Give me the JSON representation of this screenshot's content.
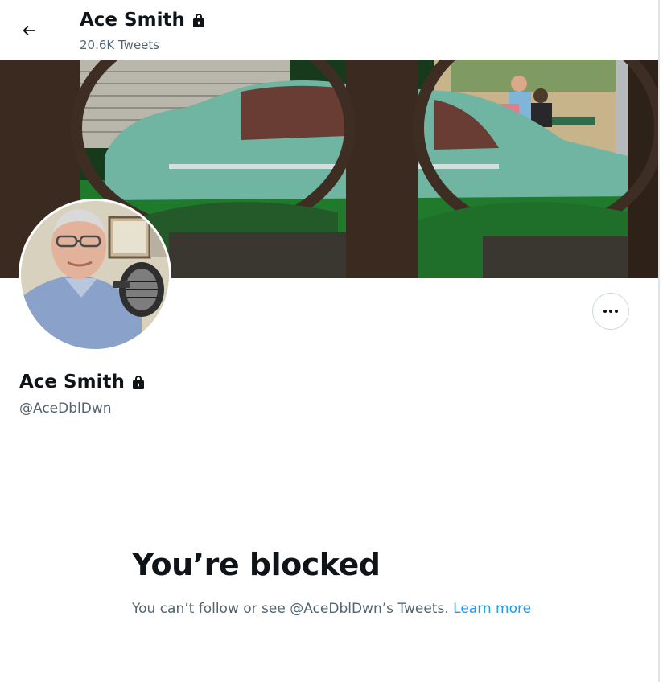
{
  "header": {
    "back_icon": "back-arrow-icon",
    "name": "Ace Smith",
    "lock_icon": "lock-icon",
    "tweet_count": "20.6K Tweets"
  },
  "banner": {
    "description_icon": "banner-image"
  },
  "profile": {
    "name": "Ace Smith",
    "lock_icon": "lock-icon",
    "handle": "@AceDblDwn",
    "more_icon": "more-options-icon"
  },
  "blocked": {
    "title": "You’re blocked",
    "message": "You can’t follow or see @AceDblDwn’s Tweets.",
    "link_label": "Learn more"
  },
  "colors": {
    "link": "#1d9bf0",
    "secondary_text": "#536471",
    "primary_text": "#0f1419"
  }
}
